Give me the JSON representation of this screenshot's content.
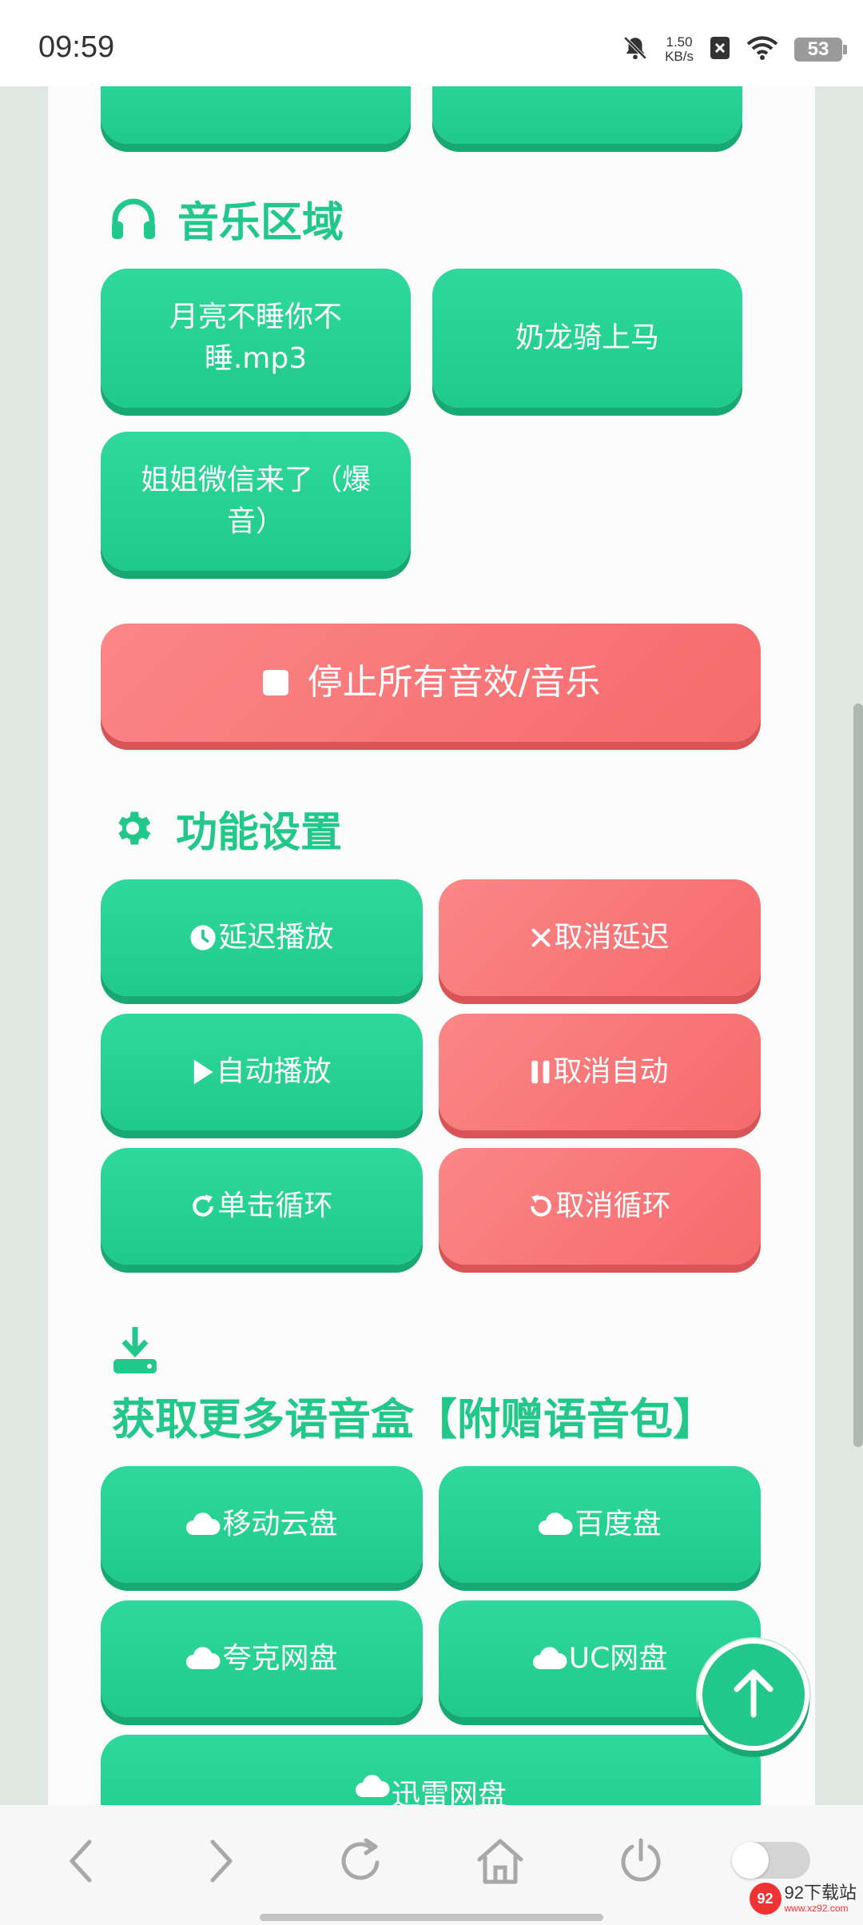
{
  "status_bar": {
    "time": "09:59",
    "net_speed_value": "1.50",
    "net_speed_unit": "KB/s",
    "battery": "53"
  },
  "colors": {
    "green": "#22c78c",
    "red": "#f66a6d",
    "gutter": "#dfe7e3"
  },
  "music": {
    "title": "音乐区域",
    "items": [
      "月亮不睡你不睡.mp3",
      "奶龙骑上马",
      "姐姐微信来了（爆音）"
    ]
  },
  "stop_button": {
    "label": "停止所有音效/音乐"
  },
  "settings": {
    "title": "功能设置",
    "delay_play": "延迟播放",
    "cancel_delay": "取消延迟",
    "auto_play": "自动播放",
    "cancel_auto": "取消自动",
    "loop_single": "单击循环",
    "cancel_loop": "取消循环"
  },
  "download": {
    "title": "获取更多语音盒【附赠语音包】",
    "links": [
      "移动云盘",
      "百度盘",
      "夸克网盘",
      "UC网盘",
      "迅雷网盘"
    ]
  },
  "watermark": {
    "title": "92下载站",
    "url": "www.xz92.com"
  },
  "icons": {
    "section_music": "headphones-icon",
    "section_settings": "gear-icon",
    "section_download": "download-icon",
    "stop": "stop-square-icon",
    "delay": "clock-icon",
    "cancel": "x-icon",
    "play": "play-icon",
    "pause": "pause-icon",
    "loop": "redo-icon",
    "undo": "undo-icon",
    "cloud": "cloud-icon",
    "fab": "arrow-up-icon"
  }
}
